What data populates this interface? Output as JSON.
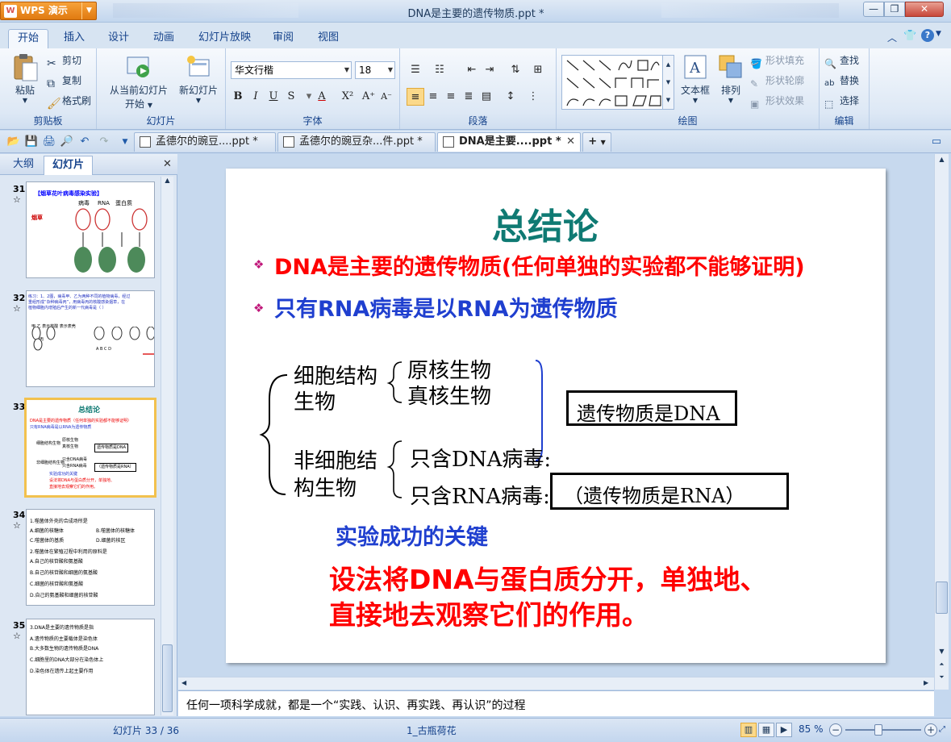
{
  "app": {
    "name": "WPS 演示",
    "window_title": "DNA是主要的遗传物质.ppt *"
  },
  "ribbon_tabs": [
    "开始",
    "插入",
    "设计",
    "动画",
    "幻灯片放映",
    "审阅",
    "视图"
  ],
  "ribbon": {
    "clipboard": {
      "paste": "粘贴",
      "cut": "剪切",
      "copy": "复制",
      "format_painter": "格式刷",
      "group_label": "剪贴板"
    },
    "slides": {
      "from_current": "从当前幻灯片",
      "start": "开始",
      "new_slide": "新幻灯片",
      "group_label": "幻灯片"
    },
    "font": {
      "family": "华文行楷",
      "size": "18",
      "group_label": "字体"
    },
    "paragraph": {
      "group_label": "段落"
    },
    "drawing": {
      "textbox": "文本框",
      "arrange": "排列",
      "shape_fill": "形状填充",
      "shape_outline": "形状轮廓",
      "shape_effect": "形状效果",
      "group_label": "绘图"
    },
    "editing": {
      "find": "查找",
      "replace": "替换",
      "select": "选择",
      "group_label": "编辑"
    }
  },
  "doc_tabs": [
    {
      "label": "孟德尔的豌豆....ppt *",
      "active": false
    },
    {
      "label": "孟德尔的豌豆杂...件.ppt *",
      "active": false
    },
    {
      "label": "DNA是主要....ppt *",
      "active": true
    }
  ],
  "left_panel": {
    "tabs": [
      "大纲",
      "幻灯片"
    ],
    "active_tab": "幻灯片"
  },
  "thumbnails": [
    {
      "num": "31",
      "lines": [
        "【烟草花叶病毒感染实验】",
        "病毒",
        "RNA",
        "蛋白质",
        "烟草",
        "RNA",
        "蛋白质"
      ]
    },
    {
      "num": "32",
      "lines": [
        "练习：1、2图，病毒甲、乙为两种不同的植物病毒，经过",
        "重组形成“杂种病毒丙”，用病毒丙的核酸感染烟草，在",
        "植物细胞内增殖后产生的新一代病毒是（   ）",
        "甲  乙  表示核酸  表示表壳",
        "丙",
        "A   B   C   D"
      ]
    },
    {
      "num": "33",
      "lines": [
        "总结论",
        "DNA是主要的遗传物质（任何单独的实验都不能够证明）",
        "只有RNA病毒是以RNA为遗传物质",
        "细胞结构生物",
        "原核生物",
        "真核生物",
        "遗传物质是DNA",
        "非细胞结构生物",
        "只含DNA病毒",
        "只含RNA病毒",
        "（遗传物质是RNA）",
        "实验成功的关键",
        "设法将DNA与蛋白质分开，单独地、",
        "直接地去观察它们的作用。"
      ]
    },
    {
      "num": "34",
      "lines": [
        "1.噬菌体外壳的合成场所是",
        "A.细菌的核糖体",
        "B.噬菌体的核糖体",
        "C.噬菌体的基质",
        "D.细菌的核区",
        "2.噬菌体在繁殖过程中利用的原料是",
        "A.自己的核苷酸和氨基酸",
        "B.自己的核苷酸和细菌的氨基酸",
        "C.细菌的核苷酸和氨基酸",
        "D.自己的氨基酸和细菌的核苷酸"
      ]
    },
    {
      "num": "35",
      "lines": [
        "3.DNA是主要的遗传物质是指",
        "A.遗传物质的主要载体是染色体",
        "B.大多数生物的遗传物质是DNA",
        "C.细胞里的DNA大部分在染色体上",
        "D.染色体在遗传上起主要作用"
      ]
    }
  ],
  "slide": {
    "title": "总结论",
    "bullet1": "DNA是主要的遗传物质(任何单独的实验都不能够证明)",
    "bullet2": "只有RNA病毒是以RNA为遗传物质",
    "cellular": "细胞结构\n生物",
    "cellular_l1": "细胞结构",
    "cellular_l2": "生物",
    "prokaryote": "原核生物",
    "eukaryote": "真核生物",
    "dna_box": "遗传物质是DNA",
    "noncellular_l1": "非细胞结",
    "noncellular_l2": "构生物",
    "dna_virus": "只含DNA病毒:",
    "rna_virus": "只含RNA病毒:",
    "rna_box": "（遗传物质是RNA）",
    "key_title": "实验成功的关键",
    "key_l1": "设法将DNA与蛋白质分开，单独地、",
    "key_l2": "直接地去观察它们的作用。",
    "colors": {
      "title": "#0f7a73",
      "red": "#ff0000",
      "blue": "#1f3fcf",
      "bullet": "#c0187a"
    }
  },
  "notes": "任何一项科学成就，都是一个“实践、认识、再实践、再认识”的过程",
  "status": {
    "slide_counter": "幻灯片 33 / 36",
    "theme": "1_古瓶荷花",
    "zoom": "85 %",
    "zoom_level": 0.85
  }
}
